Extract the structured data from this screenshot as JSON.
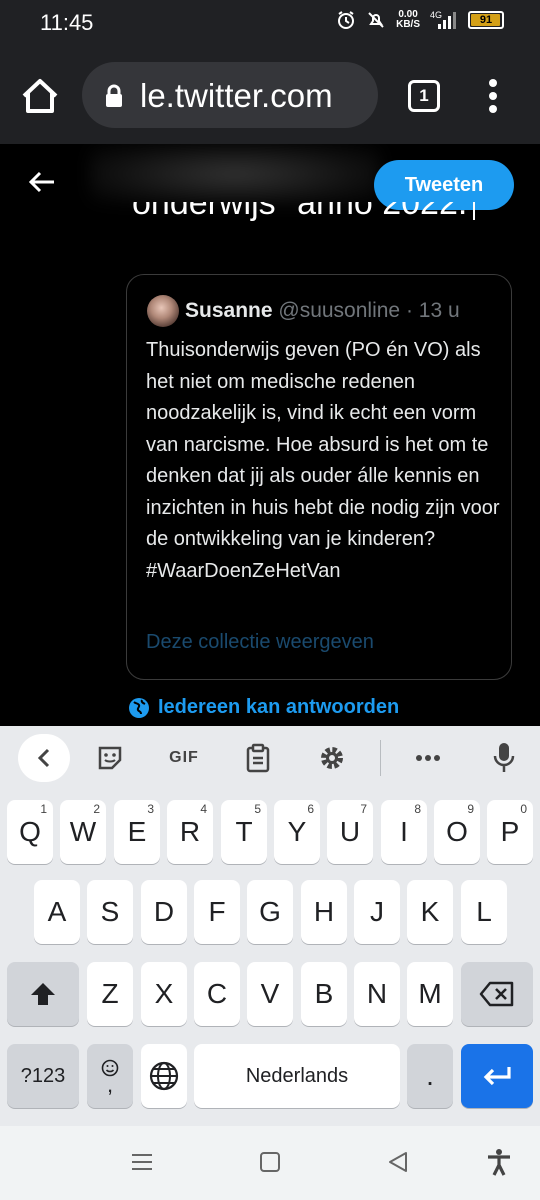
{
  "status_bar": {
    "time": "11:45",
    "speed_value": "0.00",
    "speed_unit": "KB/S",
    "network": "4G",
    "battery": "91",
    "icons": [
      "alarm-icon",
      "mute-icon",
      "signal-icon",
      "battery-icon"
    ]
  },
  "browser": {
    "url": "le.twitter.com",
    "tab_count": "1"
  },
  "compose": {
    "tweet_button": "Tweeten",
    "partial_text": "onderwijs\" anno 2022."
  },
  "quote": {
    "name": "Susanne",
    "handle": "@suusonline",
    "separator": "·",
    "time": "13 u",
    "body": "Thuisonderwijs geven (PO én VO) als het niet om medische redenen noodzakelijk is, vind ik echt een vorm van narcisme. Hoe absurd is het om te denken dat jij als ouder álle kennis en inzichten in huis hebt die nodig zijn voor de ontwikkeling van je kinderen? #WaarDoenZeHetVan",
    "link": "Deze collectie weergeven"
  },
  "reply_setting": "Iedereen kan antwoorden",
  "keyboard": {
    "toolbar_gif": "GIF",
    "row1": [
      {
        "label": "Q",
        "hint": "1"
      },
      {
        "label": "W",
        "hint": "2"
      },
      {
        "label": "E",
        "hint": "3"
      },
      {
        "label": "R",
        "hint": "4"
      },
      {
        "label": "T",
        "hint": "5"
      },
      {
        "label": "Y",
        "hint": "6"
      },
      {
        "label": "U",
        "hint": "7"
      },
      {
        "label": "I",
        "hint": "8"
      },
      {
        "label": "O",
        "hint": "9"
      },
      {
        "label": "P",
        "hint": "0"
      }
    ],
    "row2": [
      "A",
      "S",
      "D",
      "F",
      "G",
      "H",
      "J",
      "K",
      "L"
    ],
    "row3": [
      "Z",
      "X",
      "C",
      "V",
      "B",
      "N",
      "M"
    ],
    "symbols_key": "?123",
    "emoji_comma": ",",
    "space_label": "Nederlands",
    "period": "."
  },
  "colors": {
    "accent": "#1d9bf0",
    "enter_key": "#1a73e8",
    "link_dim": "#1a4a6e"
  }
}
